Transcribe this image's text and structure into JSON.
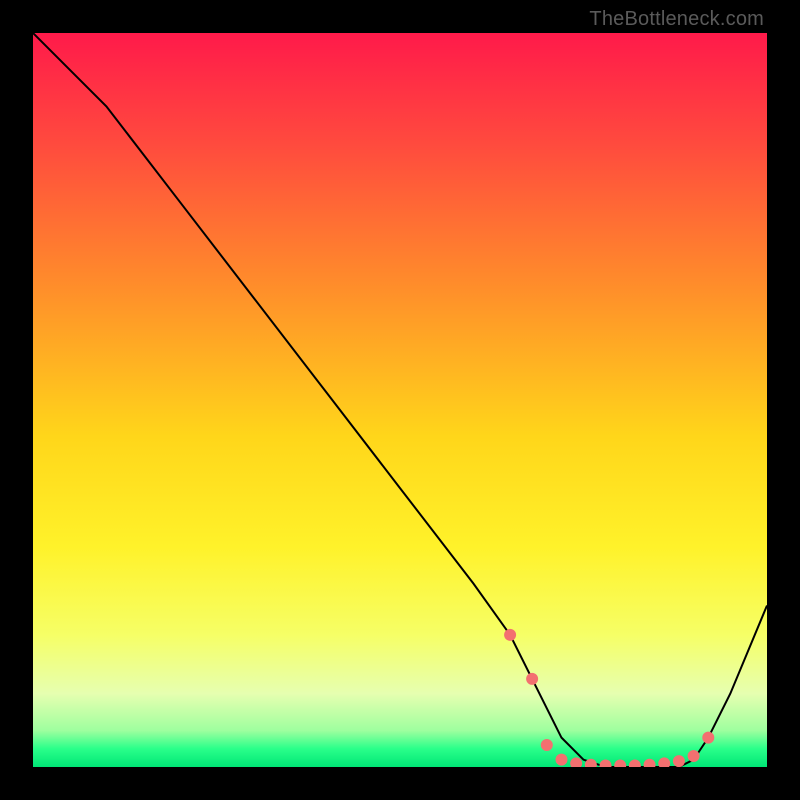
{
  "attribution": "TheBottleneck.com",
  "colors": {
    "curve_stroke": "#000000",
    "marker_fill": "#f37070",
    "marker_stroke": "#f37070"
  },
  "chart_data": {
    "type": "line",
    "title": "",
    "xlabel": "",
    "ylabel": "",
    "xlim": [
      0,
      100
    ],
    "ylim": [
      0,
      100
    ],
    "series": [
      {
        "name": "bottleneck-curve",
        "x": [
          0,
          6,
          10,
          20,
          30,
          40,
          50,
          60,
          65,
          68,
          70,
          72,
          75,
          78,
          80,
          82,
          85,
          88,
          90,
          92,
          95,
          100
        ],
        "y": [
          100,
          94,
          90,
          77,
          64,
          51,
          38,
          25,
          18,
          12,
          8,
          4,
          1,
          0,
          0,
          0,
          0,
          0,
          1,
          4,
          10,
          22
        ]
      }
    ],
    "markers": {
      "name": "bottleneck-dots",
      "x": [
        65,
        68,
        70,
        72,
        74,
        76,
        78,
        80,
        82,
        84,
        86,
        88,
        90,
        92
      ],
      "y": [
        18,
        12,
        3,
        1,
        0.5,
        0.3,
        0.2,
        0.2,
        0.2,
        0.3,
        0.5,
        0.8,
        1.5,
        4
      ]
    },
    "gradient_stops": [
      {
        "pos": 0.0,
        "color": "#ff1a4a"
      },
      {
        "pos": 0.15,
        "color": "#ff4a3e"
      },
      {
        "pos": 0.35,
        "color": "#ff8f2a"
      },
      {
        "pos": 0.55,
        "color": "#ffd61a"
      },
      {
        "pos": 0.7,
        "color": "#fff22a"
      },
      {
        "pos": 0.82,
        "color": "#f6ff66"
      },
      {
        "pos": 0.9,
        "color": "#e6ffb0"
      },
      {
        "pos": 0.95,
        "color": "#9fff9f"
      },
      {
        "pos": 0.975,
        "color": "#2aff8a"
      },
      {
        "pos": 1.0,
        "color": "#00e676"
      }
    ]
  }
}
